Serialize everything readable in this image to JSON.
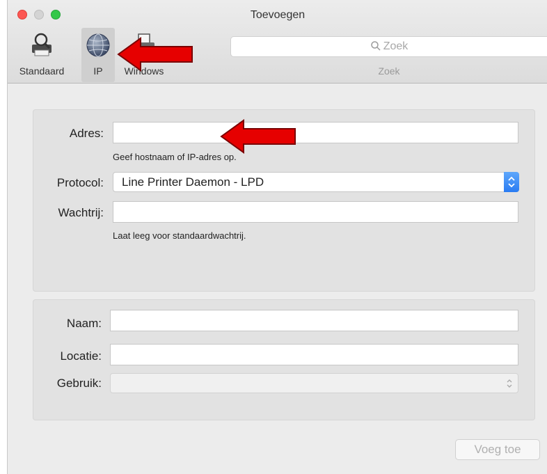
{
  "window": {
    "title": "Toevoegen"
  },
  "toolbar": {
    "tabs": [
      {
        "label": "Standaard",
        "icon": "printer-search-icon"
      },
      {
        "label": "IP",
        "icon": "globe-icon",
        "selected": true
      },
      {
        "label": "Windows",
        "icon": "windows-printer-icon"
      }
    ],
    "search": {
      "placeholder": "Zoek",
      "label": "Zoek"
    }
  },
  "connection": {
    "address_label": "Adres:",
    "address_value": "",
    "address_hint": "Geef hostnaam of IP-adres op.",
    "protocol_label": "Protocol:",
    "protocol_value": "Line Printer Daemon - LPD",
    "queue_label": "Wachtrij:",
    "queue_value": "",
    "queue_hint": "Laat leeg voor standaardwachtrij."
  },
  "details": {
    "name_label": "Naam:",
    "name_value": "",
    "location_label": "Locatie:",
    "location_value": "",
    "use_label": "Gebruik:",
    "use_value": ""
  },
  "actions": {
    "add_label": "Voeg toe",
    "add_enabled": false
  },
  "colors": {
    "accent": "#2a7cf2",
    "annotation_arrow": "#e60000",
    "close": "#fc5753",
    "zoom": "#34c84a"
  }
}
